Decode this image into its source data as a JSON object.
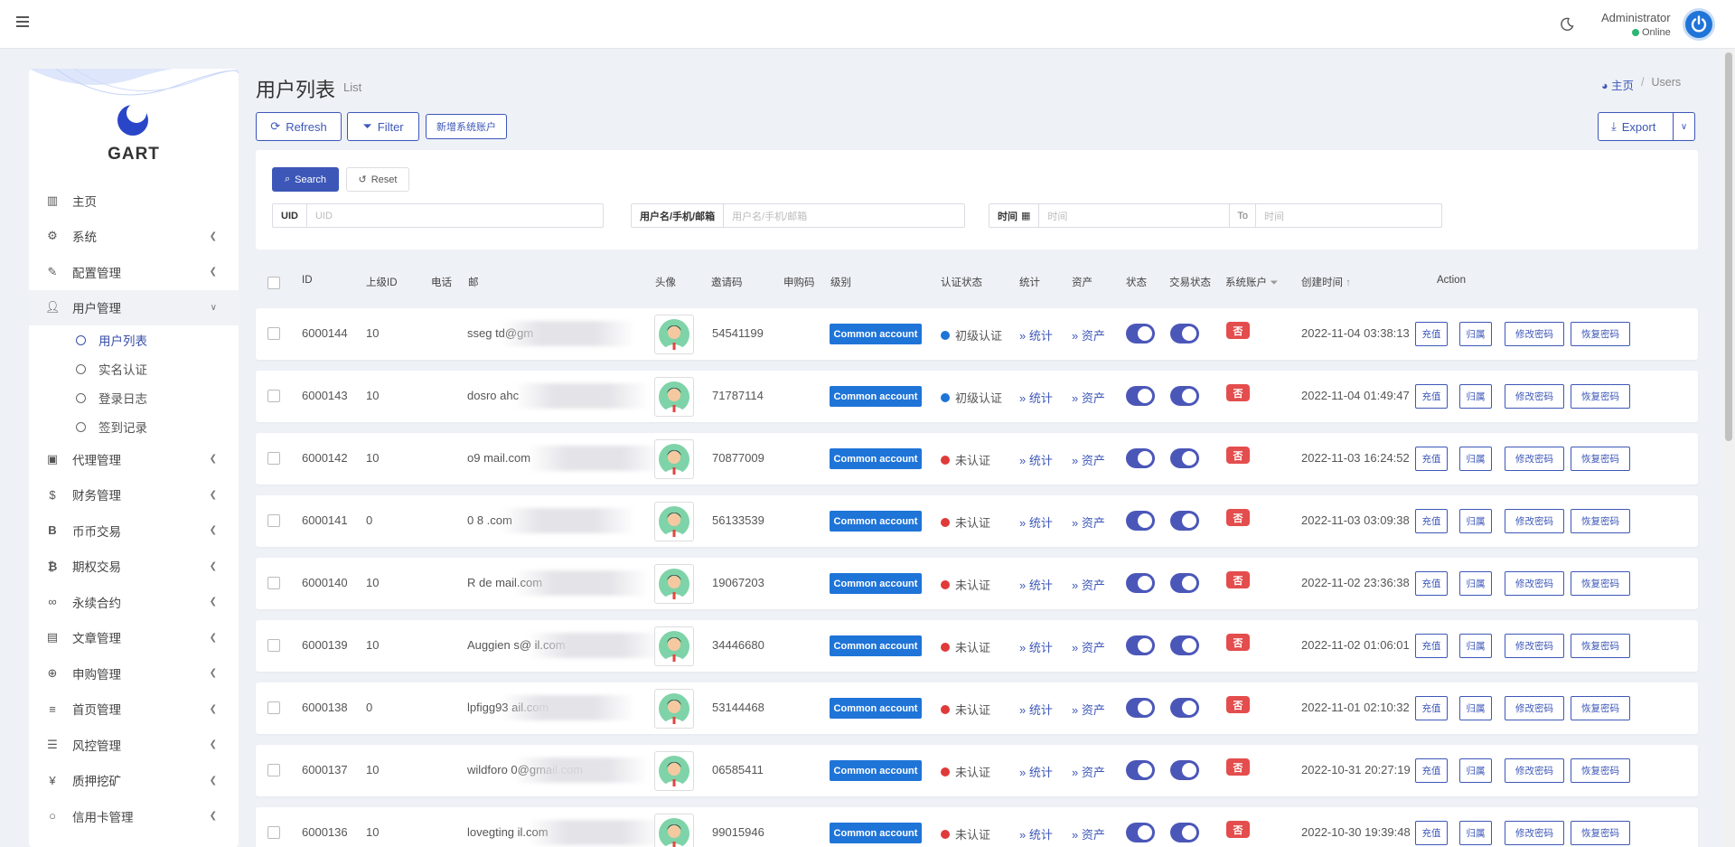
{
  "header": {
    "user_name": "Administrator",
    "status": "Online"
  },
  "sidebar": {
    "logo": "GART",
    "items": [
      {
        "label": "主页",
        "icon": "bar-chart-icon",
        "has_children": false
      },
      {
        "label": "系统",
        "icon": "gear-icon",
        "has_children": true
      },
      {
        "label": "配置管理",
        "icon": "wrench-icon",
        "has_children": true
      },
      {
        "label": "用户管理",
        "icon": "user-icon",
        "has_children": true,
        "expanded": true
      }
    ],
    "sub_items": [
      "用户列表",
      "实名认证",
      "登录日志",
      "签到记录"
    ],
    "items_after": [
      {
        "label": "代理管理",
        "icon": "id-card-icon"
      },
      {
        "label": "财务管理",
        "icon": "dollar-icon"
      },
      {
        "label": "币币交易",
        "icon": "bitcoin-b-icon"
      },
      {
        "label": "期权交易",
        "icon": "bitcoin-icon"
      },
      {
        "label": "永续合约",
        "icon": "link-icon"
      },
      {
        "label": "文章管理",
        "icon": "newspaper-icon"
      },
      {
        "label": "申购管理",
        "icon": "lifebuoy-icon"
      },
      {
        "label": "首页管理",
        "icon": "list-icon"
      },
      {
        "label": "风控管理",
        "icon": "list-ul-icon"
      },
      {
        "label": "质押挖矿",
        "icon": "yen-icon"
      },
      {
        "label": "信用卡管理",
        "icon": "circle-icon"
      }
    ]
  },
  "page": {
    "title": "用户列表",
    "subtitle": "List",
    "breadcrumb_home": "主页",
    "breadcrumb_current": "Users",
    "btn_refresh": "Refresh",
    "btn_filter": "Filter",
    "btn_new_system_account": "新增系统账户",
    "btn_export": "Export"
  },
  "filter": {
    "search": "Search",
    "reset": "Reset",
    "uid_label": "UID",
    "uid_placeholder": "UID",
    "user_label": "用户名/手机/邮箱",
    "user_placeholder": "用户名/手机/邮箱",
    "time_label": "时间",
    "time_placeholder": "时间",
    "to_label": "To",
    "time_to_placeholder": "时间"
  },
  "table": {
    "columns": [
      "ID",
      "上级ID",
      "电话",
      "邮",
      "头像",
      "邀请码",
      "申购码",
      "级别",
      "认证状态",
      "统计",
      "资产",
      "状态",
      "交易状态",
      "系统账户",
      "创建时间",
      "Action"
    ],
    "stat_link": "统计",
    "asset_link": "资产",
    "actions": [
      "充值",
      "归属",
      "修改密码",
      "恢复密码"
    ],
    "level_badge": "Common account",
    "system_badge": "否",
    "colors": {
      "verified": "#1f74d8",
      "unverified": "#e03a3a",
      "accent": "#3d57b8"
    },
    "rows": [
      {
        "id": "6000144",
        "parent": "10",
        "email": "sseg      td@gm",
        "invite": "54541199",
        "auth": "初级认证",
        "verified": true,
        "created": "2022-11-04 03:38:13"
      },
      {
        "id": "6000143",
        "parent": "10",
        "email": "     dosro  ahc",
        "invite": "71787114",
        "auth": "初级认证",
        "verified": true,
        "created": "2022-11-04 01:49:47"
      },
      {
        "id": "6000142",
        "parent": "10",
        "email": "o9            mail.com",
        "invite": "70877009",
        "auth": "未认证",
        "verified": false,
        "created": "2022-11-03 16:24:52"
      },
      {
        "id": "6000141",
        "parent": "0",
        "email": "  0  8         .com",
        "invite": "56133539",
        "auth": "未认证",
        "verified": false,
        "created": "2022-11-03 03:09:38"
      },
      {
        "id": "6000140",
        "parent": "10",
        "email": "R      de            mail.com",
        "invite": "19067203",
        "auth": "未认证",
        "verified": false,
        "created": "2022-11-02 23:36:38"
      },
      {
        "id": "6000139",
        "parent": "10",
        "email": "Auggien          s@   il.com",
        "invite": "34446680",
        "auth": "未认证",
        "verified": false,
        "created": "2022-11-02 01:06:01"
      },
      {
        "id": "6000138",
        "parent": "0",
        "email": "lpfigg93       ail.com",
        "invite": "53144468",
        "auth": "未认证",
        "verified": false,
        "created": "2022-11-01 02:10:32"
      },
      {
        "id": "6000137",
        "parent": "10",
        "email": "wildforo      0@gmail.com",
        "invite": "06585411",
        "auth": "未认证",
        "verified": false,
        "created": "2022-10-31 20:27:19"
      },
      {
        "id": "6000136",
        "parent": "10",
        "email": "lovegting          il.com",
        "invite": "99015946",
        "auth": "未认证",
        "verified": false,
        "created": "2022-10-30 19:39:48"
      }
    ]
  }
}
